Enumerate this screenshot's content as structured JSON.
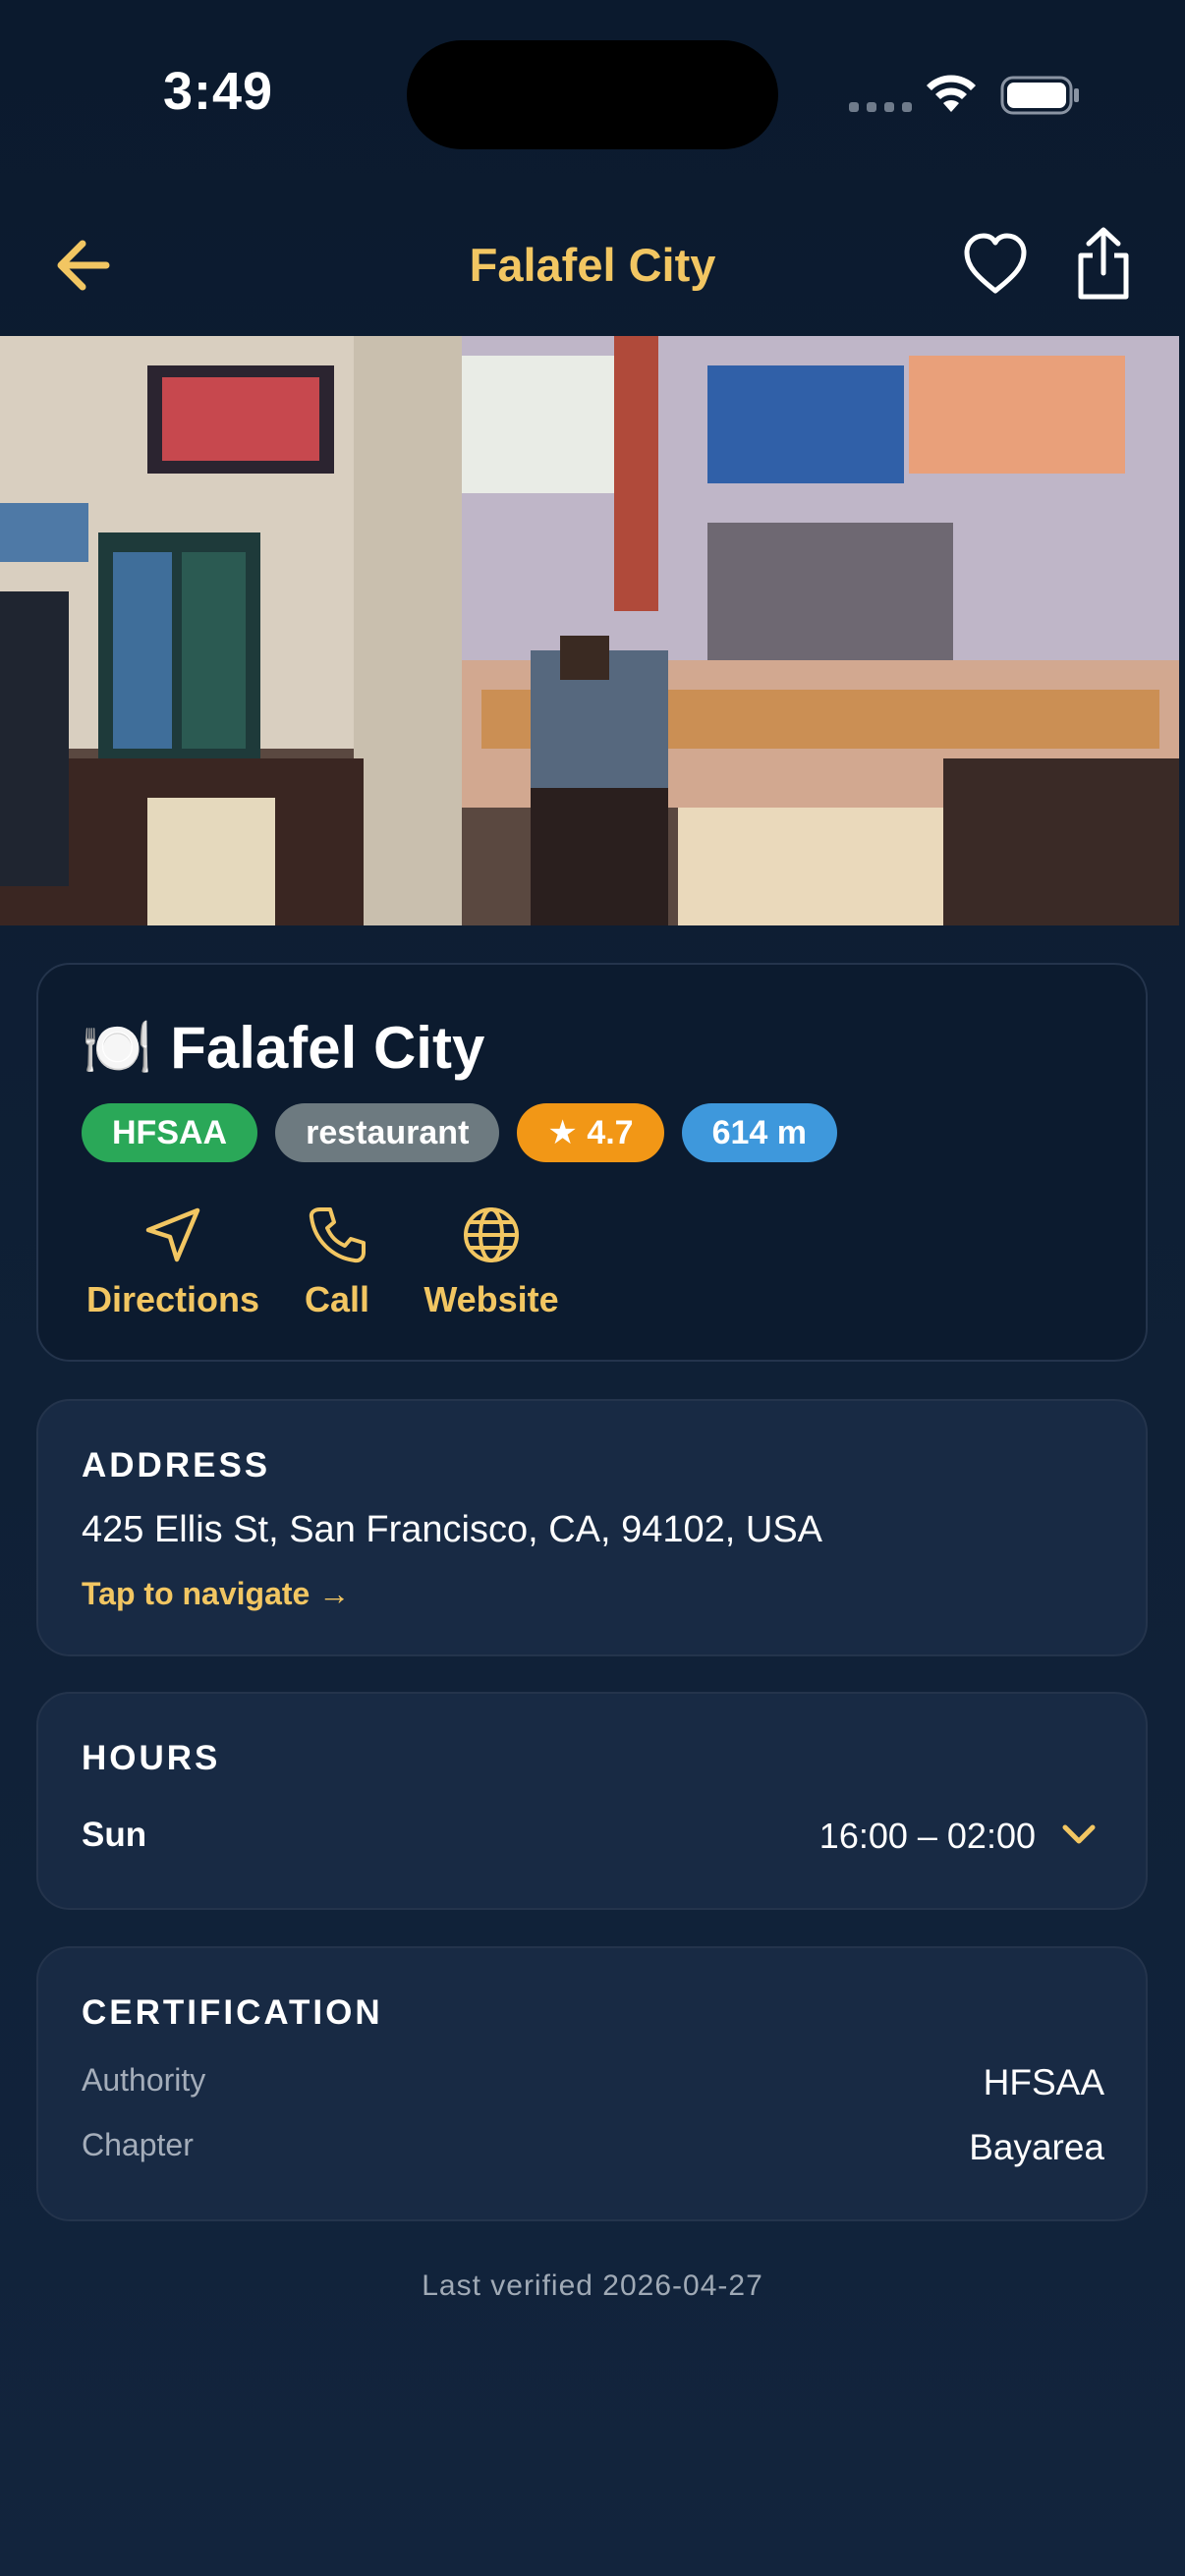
{
  "status_bar": {
    "time": "3:49"
  },
  "nav": {
    "title": "Falafel City"
  },
  "place": {
    "emoji": "🍽️",
    "name": "Falafel City",
    "badges": {
      "authority": "HFSAA",
      "category": "restaurant",
      "rating": "★ 4.7",
      "distance": "614 m"
    },
    "actions": {
      "directions": "Directions",
      "call": "Call",
      "website": "Website"
    }
  },
  "address": {
    "label": "ADDRESS",
    "text": "425 Ellis St, San Francisco, CA, 94102, USA",
    "link": "Tap to navigate →"
  },
  "hours": {
    "label": "HOURS",
    "day": "Sun",
    "time": "16:00 – 02:00"
  },
  "certification": {
    "label": "CERTIFICATION",
    "authority_label": "Authority",
    "authority_value": "HFSAA",
    "chapter_label": "Chapter",
    "chapter_value": "Bayarea"
  },
  "footer": {
    "last_verified": "Last verified 2026-04-27"
  },
  "colors": {
    "accent": "#f2c662",
    "badge_green": "#2aa858",
    "badge_gray": "#6d7a80",
    "badge_orange": "#f29716",
    "badge_blue": "#3e98dc"
  },
  "icons": [
    "back-arrow-icon",
    "heart-icon",
    "share-icon",
    "navigation-arrow-icon",
    "phone-icon",
    "globe-icon",
    "chevron-down-icon",
    "wifi-icon",
    "battery-icon"
  ]
}
